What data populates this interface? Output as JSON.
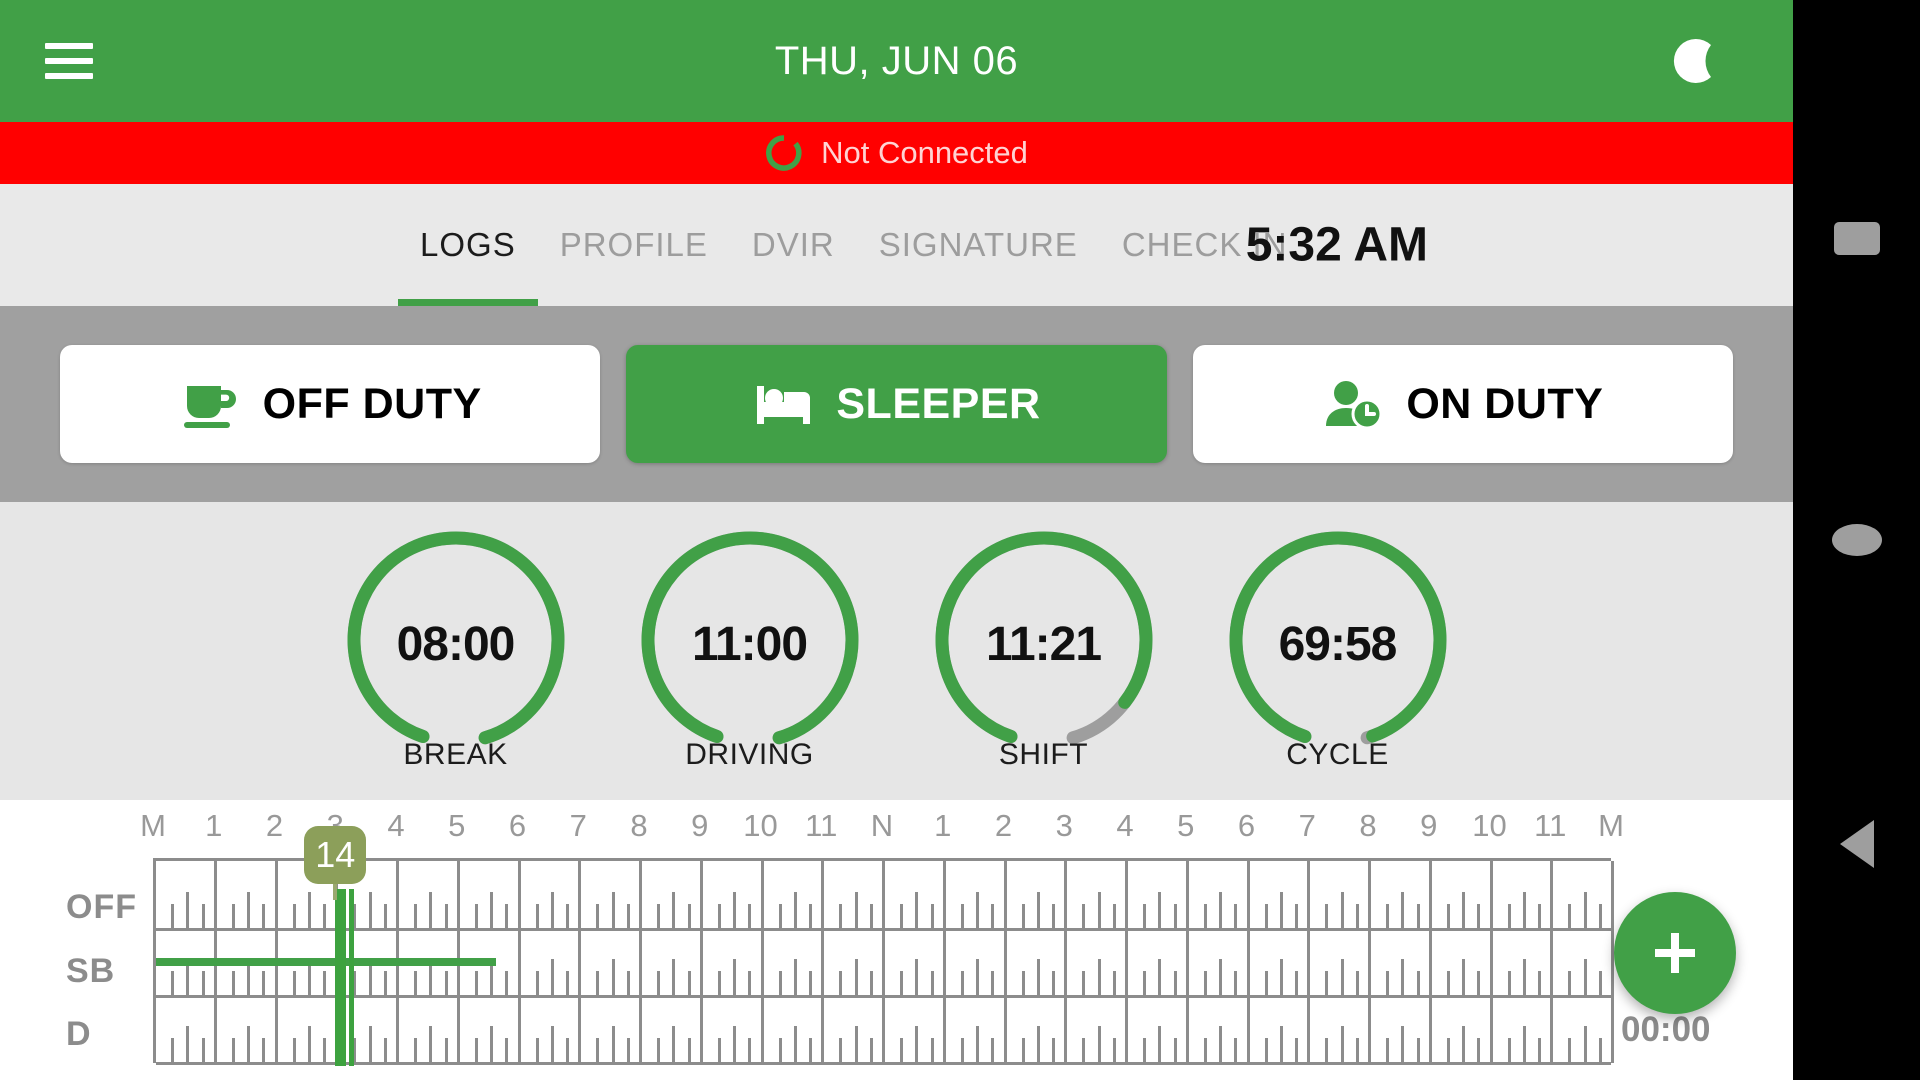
{
  "appbar": {
    "title": "THU, JUN 06",
    "menu_icon": "hamburger-menu-icon",
    "night_icon": "crescent-moon-icon"
  },
  "banner": {
    "text": "Not Connected",
    "icon": "refresh-spinner-icon",
    "background": "#ff0000",
    "text_color": "#ffd3d3"
  },
  "tabs": [
    {
      "label": "LOGS",
      "active": true
    },
    {
      "label": "PROFILE",
      "active": false
    },
    {
      "label": "DVIR",
      "active": false
    },
    {
      "label": "SIGNATURE",
      "active": false
    },
    {
      "label": "CHECK IN",
      "active": false
    }
  ],
  "clock": "5:32 AM",
  "duty_buttons": [
    {
      "label": "OFF DUTY",
      "icon": "coffee-cup-icon",
      "active": false
    },
    {
      "label": "SLEEPER",
      "icon": "bed-icon",
      "active": true
    },
    {
      "label": "ON DUTY",
      "icon": "person-clock-icon",
      "active": false
    }
  ],
  "gauges": [
    {
      "value": "08:00",
      "caption": "BREAK",
      "progress": 100
    },
    {
      "value": "11:00",
      "caption": "DRIVING",
      "progress": 100
    },
    {
      "value": "11:21",
      "caption": "SHIFT",
      "progress": 89
    },
    {
      "value": "69:58",
      "caption": "CYCLE",
      "progress": 99
    }
  ],
  "log_grid": {
    "hour_labels": [
      "M",
      "1",
      "2",
      "3",
      "4",
      "5",
      "6",
      "7",
      "8",
      "9",
      "10",
      "11",
      "N",
      "1",
      "2",
      "3",
      "4",
      "5",
      "6",
      "7",
      "8",
      "9",
      "10",
      "11",
      "M"
    ],
    "row_labels": [
      "OFF",
      "SB",
      "D"
    ],
    "event_marker": {
      "label": "14",
      "hour": 3
    },
    "sb_segment": {
      "start_hour": 0,
      "end_hour": 5.6
    },
    "day_total": "00:00"
  },
  "fab": {
    "icon": "plus-icon",
    "label": "+"
  },
  "navbar": [
    {
      "name": "recents",
      "icon": "square-icon"
    },
    {
      "name": "home",
      "icon": "circle-icon"
    },
    {
      "name": "back",
      "icon": "triangle-left-icon"
    }
  ],
  "colors": {
    "brand_green": "#41a047",
    "danger_red": "#ff0000",
    "gray_band": "#a0a0a0",
    "gauge_bg": "#e6e6e6",
    "badge_olive": "#8c9f5a"
  }
}
